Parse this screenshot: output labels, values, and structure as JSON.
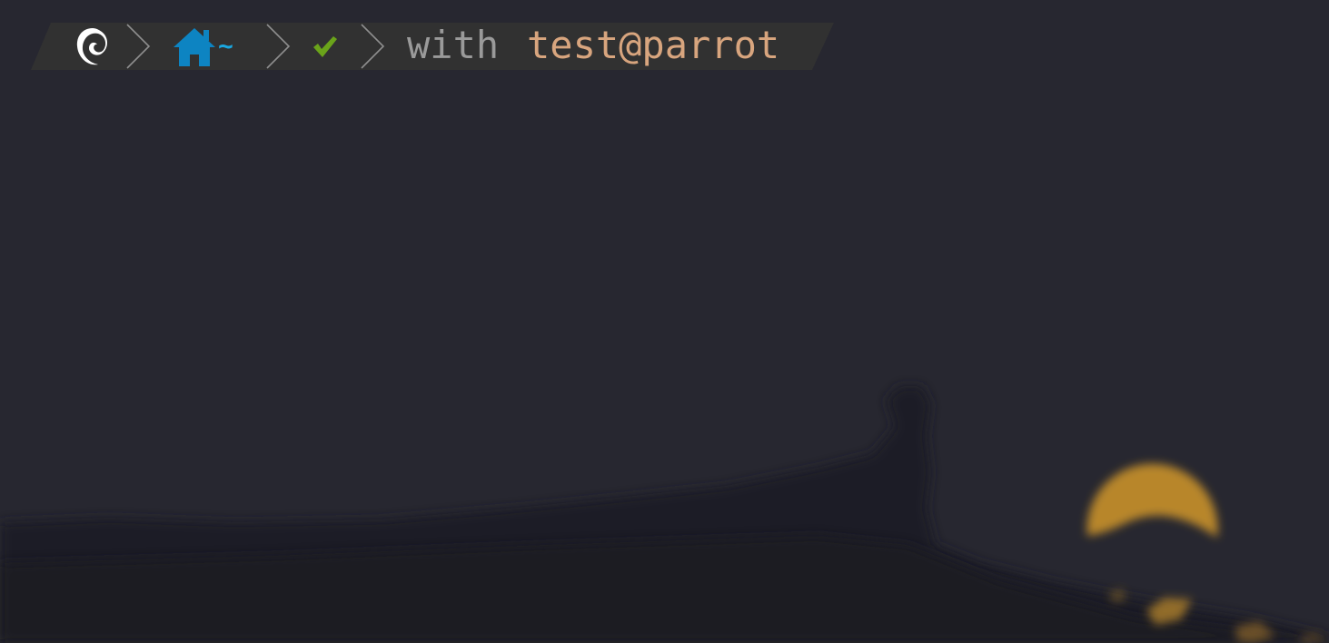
{
  "prompt": {
    "os_icon": "debian-swirl-icon",
    "home_icon": "home-icon",
    "directory": "~",
    "status_icon": "check-icon",
    "with_label": "with",
    "user_host": "test@parrot"
  },
  "colors": {
    "background": "#272730",
    "prompt_bar": "#313131",
    "home_accent": "#0d84c2",
    "tilde": "#1aa7e0",
    "check": "#6aa31a",
    "with_text": "#9a9a9a",
    "user_host": "#d8a57e",
    "moon": "#b8862b"
  }
}
